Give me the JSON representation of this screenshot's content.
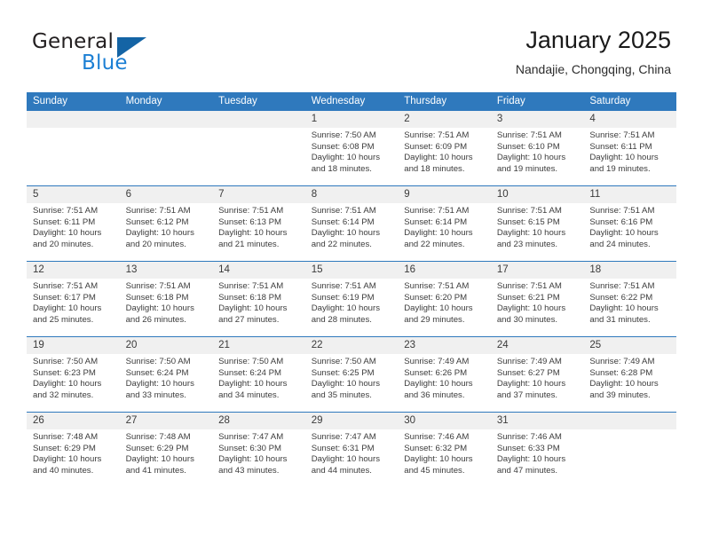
{
  "brand": {
    "word_one": "General",
    "word_two": "Blue",
    "logo_icon": "triangle-logo-icon",
    "accent": "#1464a5",
    "blue_text": "#1b7fd4"
  },
  "header": {
    "title": "January 2025",
    "subtitle": "Nandajie, Chongqing, China",
    "header_bg": "#2f79bd"
  },
  "calendar": {
    "weekday_headers": [
      "Sunday",
      "Monday",
      "Tuesday",
      "Wednesday",
      "Thursday",
      "Friday",
      "Saturday"
    ],
    "weeks": [
      [
        {
          "day": "",
          "lines": []
        },
        {
          "day": "",
          "lines": []
        },
        {
          "day": "",
          "lines": []
        },
        {
          "day": "1",
          "lines": [
            "Sunrise: 7:50 AM",
            "Sunset: 6:08 PM",
            "Daylight: 10 hours",
            "and 18 minutes."
          ]
        },
        {
          "day": "2",
          "lines": [
            "Sunrise: 7:51 AM",
            "Sunset: 6:09 PM",
            "Daylight: 10 hours",
            "and 18 minutes."
          ]
        },
        {
          "day": "3",
          "lines": [
            "Sunrise: 7:51 AM",
            "Sunset: 6:10 PM",
            "Daylight: 10 hours",
            "and 19 minutes."
          ]
        },
        {
          "day": "4",
          "lines": [
            "Sunrise: 7:51 AM",
            "Sunset: 6:11 PM",
            "Daylight: 10 hours",
            "and 19 minutes."
          ]
        }
      ],
      [
        {
          "day": "5",
          "lines": [
            "Sunrise: 7:51 AM",
            "Sunset: 6:11 PM",
            "Daylight: 10 hours",
            "and 20 minutes."
          ]
        },
        {
          "day": "6",
          "lines": [
            "Sunrise: 7:51 AM",
            "Sunset: 6:12 PM",
            "Daylight: 10 hours",
            "and 20 minutes."
          ]
        },
        {
          "day": "7",
          "lines": [
            "Sunrise: 7:51 AM",
            "Sunset: 6:13 PM",
            "Daylight: 10 hours",
            "and 21 minutes."
          ]
        },
        {
          "day": "8",
          "lines": [
            "Sunrise: 7:51 AM",
            "Sunset: 6:14 PM",
            "Daylight: 10 hours",
            "and 22 minutes."
          ]
        },
        {
          "day": "9",
          "lines": [
            "Sunrise: 7:51 AM",
            "Sunset: 6:14 PM",
            "Daylight: 10 hours",
            "and 22 minutes."
          ]
        },
        {
          "day": "10",
          "lines": [
            "Sunrise: 7:51 AM",
            "Sunset: 6:15 PM",
            "Daylight: 10 hours",
            "and 23 minutes."
          ]
        },
        {
          "day": "11",
          "lines": [
            "Sunrise: 7:51 AM",
            "Sunset: 6:16 PM",
            "Daylight: 10 hours",
            "and 24 minutes."
          ]
        }
      ],
      [
        {
          "day": "12",
          "lines": [
            "Sunrise: 7:51 AM",
            "Sunset: 6:17 PM",
            "Daylight: 10 hours",
            "and 25 minutes."
          ]
        },
        {
          "day": "13",
          "lines": [
            "Sunrise: 7:51 AM",
            "Sunset: 6:18 PM",
            "Daylight: 10 hours",
            "and 26 minutes."
          ]
        },
        {
          "day": "14",
          "lines": [
            "Sunrise: 7:51 AM",
            "Sunset: 6:18 PM",
            "Daylight: 10 hours",
            "and 27 minutes."
          ]
        },
        {
          "day": "15",
          "lines": [
            "Sunrise: 7:51 AM",
            "Sunset: 6:19 PM",
            "Daylight: 10 hours",
            "and 28 minutes."
          ]
        },
        {
          "day": "16",
          "lines": [
            "Sunrise: 7:51 AM",
            "Sunset: 6:20 PM",
            "Daylight: 10 hours",
            "and 29 minutes."
          ]
        },
        {
          "day": "17",
          "lines": [
            "Sunrise: 7:51 AM",
            "Sunset: 6:21 PM",
            "Daylight: 10 hours",
            "and 30 minutes."
          ]
        },
        {
          "day": "18",
          "lines": [
            "Sunrise: 7:51 AM",
            "Sunset: 6:22 PM",
            "Daylight: 10 hours",
            "and 31 minutes."
          ]
        }
      ],
      [
        {
          "day": "19",
          "lines": [
            "Sunrise: 7:50 AM",
            "Sunset: 6:23 PM",
            "Daylight: 10 hours",
            "and 32 minutes."
          ]
        },
        {
          "day": "20",
          "lines": [
            "Sunrise: 7:50 AM",
            "Sunset: 6:24 PM",
            "Daylight: 10 hours",
            "and 33 minutes."
          ]
        },
        {
          "day": "21",
          "lines": [
            "Sunrise: 7:50 AM",
            "Sunset: 6:24 PM",
            "Daylight: 10 hours",
            "and 34 minutes."
          ]
        },
        {
          "day": "22",
          "lines": [
            "Sunrise: 7:50 AM",
            "Sunset: 6:25 PM",
            "Daylight: 10 hours",
            "and 35 minutes."
          ]
        },
        {
          "day": "23",
          "lines": [
            "Sunrise: 7:49 AM",
            "Sunset: 6:26 PM",
            "Daylight: 10 hours",
            "and 36 minutes."
          ]
        },
        {
          "day": "24",
          "lines": [
            "Sunrise: 7:49 AM",
            "Sunset: 6:27 PM",
            "Daylight: 10 hours",
            "and 37 minutes."
          ]
        },
        {
          "day": "25",
          "lines": [
            "Sunrise: 7:49 AM",
            "Sunset: 6:28 PM",
            "Daylight: 10 hours",
            "and 39 minutes."
          ]
        }
      ],
      [
        {
          "day": "26",
          "lines": [
            "Sunrise: 7:48 AM",
            "Sunset: 6:29 PM",
            "Daylight: 10 hours",
            "and 40 minutes."
          ]
        },
        {
          "day": "27",
          "lines": [
            "Sunrise: 7:48 AM",
            "Sunset: 6:29 PM",
            "Daylight: 10 hours",
            "and 41 minutes."
          ]
        },
        {
          "day": "28",
          "lines": [
            "Sunrise: 7:47 AM",
            "Sunset: 6:30 PM",
            "Daylight: 10 hours",
            "and 43 minutes."
          ]
        },
        {
          "day": "29",
          "lines": [
            "Sunrise: 7:47 AM",
            "Sunset: 6:31 PM",
            "Daylight: 10 hours",
            "and 44 minutes."
          ]
        },
        {
          "day": "30",
          "lines": [
            "Sunrise: 7:46 AM",
            "Sunset: 6:32 PM",
            "Daylight: 10 hours",
            "and 45 minutes."
          ]
        },
        {
          "day": "31",
          "lines": [
            "Sunrise: 7:46 AM",
            "Sunset: 6:33 PM",
            "Daylight: 10 hours",
            "and 47 minutes."
          ]
        },
        {
          "day": "",
          "lines": []
        }
      ]
    ]
  }
}
